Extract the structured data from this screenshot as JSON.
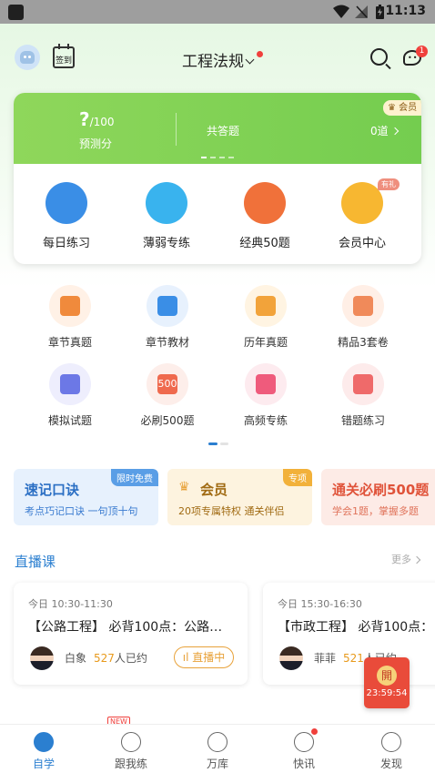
{
  "status_bar": {
    "time": "11:13"
  },
  "header": {
    "checkin_label": "签到",
    "title": "工程法规",
    "message_badge": "1"
  },
  "card": {
    "score_main": "?",
    "score_suffix": "/100",
    "score_label": "预测分",
    "answered_label": "共答题",
    "answered_value": "0道",
    "vip_tag": "会员",
    "quick_items": [
      {
        "label": "每日练习",
        "icon": "clock-icon",
        "color": "#3a8ee6"
      },
      {
        "label": "薄弱专练",
        "icon": "robot-icon",
        "color": "#39b3ee"
      },
      {
        "label": "经典50题",
        "icon": "fire-book-icon",
        "color": "#f0713a"
      },
      {
        "label": "会员中心",
        "icon": "crown-icon",
        "color": "#f7b731"
      }
    ],
    "gift_tag": "有礼"
  },
  "grid": [
    {
      "label": "章节真题",
      "icon": "head-icon",
      "bg": "#fff1e6",
      "fg": "#f08a3c"
    },
    {
      "label": "章节教材",
      "icon": "shield-book-icon",
      "bg": "#e7f1fd",
      "fg": "#3a8ee6"
    },
    {
      "label": "历年真题",
      "icon": "folder-icon",
      "bg": "#fff4e2",
      "fg": "#f2a33a"
    },
    {
      "label": "精品3套卷",
      "icon": "checklist-icon",
      "bg": "#ffefe6",
      "fg": "#f08a5a"
    },
    {
      "label": "模拟试题",
      "icon": "exam-icon",
      "bg": "#eeeefd",
      "fg": "#6c78e6"
    },
    {
      "label": "必刷500题",
      "icon": "500-icon",
      "bg": "#fdeeea",
      "fg": "#ef6a4e",
      "icon_text": "500"
    },
    {
      "label": "高频专练",
      "icon": "arrow-up-icon",
      "bg": "#fdebef",
      "fg": "#ef5b7c"
    },
    {
      "label": "错题练习",
      "icon": "wrong-icon",
      "bg": "#fdebeb",
      "fg": "#ef6a6a"
    }
  ],
  "promos": [
    {
      "title": "速记口诀",
      "subtitle": "考点巧记口诀 一句顶十句",
      "tag": "限时免费",
      "bg": "#e7f1fd",
      "title_color": "#2b6fc4",
      "sub_color": "#3a7bd0",
      "tag_bg": "#5a9ee6"
    },
    {
      "title": "会员",
      "subtitle": "20项专属特权 通关伴侣",
      "tag": "专项",
      "bg": "#fdf3df",
      "title_color": "#a06a12",
      "sub_color": "#a06a12",
      "tag_bg": "#f2b13a"
    },
    {
      "title": "通关必刷500题",
      "subtitle": "学会1题，掌握多题",
      "tag": "",
      "bg": "#fdebe6",
      "title_color": "#e0533a",
      "sub_color": "#e0735a",
      "tag_bg": "#f2b13a"
    }
  ],
  "live": {
    "section_title": "直播课",
    "more": "更多",
    "cards": [
      {
        "time": "今日 10:30-11:30",
        "name": "【公路工程】 必背100点：公路…",
        "teacher": "白象",
        "count": "527",
        "count_suffix": "人已约",
        "button": "直播中"
      },
      {
        "time": "今日 15:30-16:30",
        "name": "【市政工程】 必背100点：",
        "teacher": "菲菲",
        "count": "521",
        "count_suffix": "人已约",
        "button": ""
      }
    ],
    "float": {
      "label": "開",
      "countdown": "23:59:54"
    },
    "new_tag": "NEW"
  },
  "tabbar": [
    {
      "label": "自学",
      "active": true
    },
    {
      "label": "跟我练",
      "active": false
    },
    {
      "label": "万库",
      "active": false
    },
    {
      "label": "快讯",
      "active": false
    },
    {
      "label": "发现",
      "active": false
    }
  ]
}
